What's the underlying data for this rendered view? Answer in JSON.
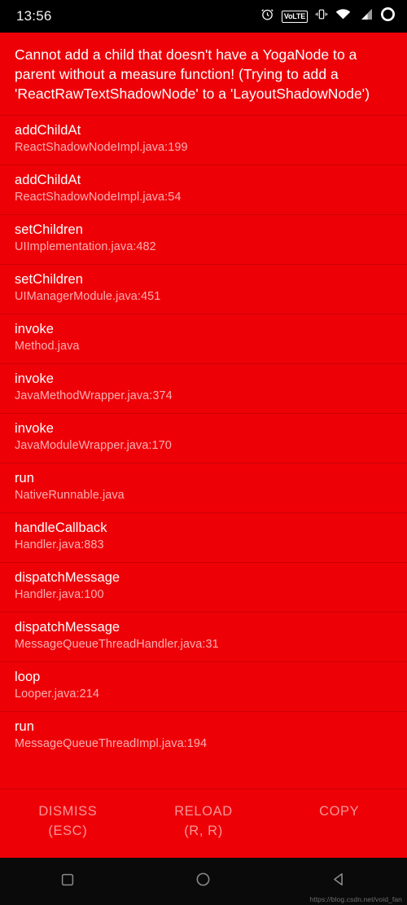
{
  "status_bar": {
    "time": "13:56",
    "icons": [
      {
        "name": "alarm-clock-icon",
        "label": "alarm"
      },
      {
        "name": "volte-icon",
        "label": "VoLTE"
      },
      {
        "name": "vibrate-mode-icon",
        "label": "vibrate"
      },
      {
        "name": "wifi-icon",
        "label": "wifi"
      },
      {
        "name": "cellular-signal-icon",
        "label": "signal"
      },
      {
        "name": "battery-icon",
        "label": "battery"
      }
    ],
    "volte_text": "VoLTE"
  },
  "error": {
    "message": "Cannot add a child that doesn't have a YogaNode to a parent without a measure function! (Trying to add a 'ReactRawTextShadowNode' to a 'LayoutShadowNode')",
    "background_color": "#EE0007",
    "text_color": "#FFFFFF"
  },
  "stack_trace": [
    {
      "method": "addChildAt",
      "file": "ReactShadowNodeImpl.java:199"
    },
    {
      "method": "addChildAt",
      "file": "ReactShadowNodeImpl.java:54"
    },
    {
      "method": "setChildren",
      "file": "UIImplementation.java:482"
    },
    {
      "method": "setChildren",
      "file": "UIManagerModule.java:451"
    },
    {
      "method": "invoke",
      "file": "Method.java"
    },
    {
      "method": "invoke",
      "file": "JavaMethodWrapper.java:374"
    },
    {
      "method": "invoke",
      "file": "JavaModuleWrapper.java:170"
    },
    {
      "method": "run",
      "file": "NativeRunnable.java"
    },
    {
      "method": "handleCallback",
      "file": "Handler.java:883"
    },
    {
      "method": "dispatchMessage",
      "file": "Handler.java:100"
    },
    {
      "method": "dispatchMessage",
      "file": "MessageQueueThreadHandler.java:31"
    },
    {
      "method": "loop",
      "file": "Looper.java:214"
    },
    {
      "method": "run",
      "file": "MessageQueueThreadImpl.java:194"
    }
  ],
  "actions": [
    {
      "label": "DISMISS",
      "shortcut": "(ESC)",
      "name": "dismiss-button"
    },
    {
      "label": "RELOAD",
      "shortcut": "(R, R)",
      "name": "reload-button"
    },
    {
      "label": "COPY",
      "shortcut": "",
      "name": "copy-button"
    }
  ],
  "nav_bar": {
    "buttons": [
      {
        "name": "recents-button",
        "icon": "square-icon"
      },
      {
        "name": "home-button",
        "icon": "circle-icon"
      },
      {
        "name": "back-button",
        "icon": "triangle-left-icon"
      }
    ]
  },
  "watermark": "https://blog.csdn.net/void_fan"
}
